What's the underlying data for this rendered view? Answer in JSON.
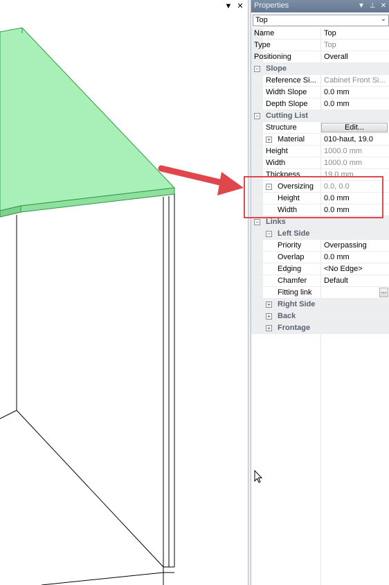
{
  "viewport": {
    "dropdown_icon": "triangle-down-icon",
    "close_icon": "close-icon",
    "dropdown_glyph": "▼",
    "close_glyph": "✕"
  },
  "panel": {
    "title": "Properties",
    "title_buttons": [
      "▼",
      "⊥",
      "✕"
    ],
    "selected_object": "Top"
  },
  "rows": {
    "name": {
      "label": "Name",
      "value": "Top"
    },
    "type": {
      "label": "Type",
      "value": "Top"
    },
    "positioning": {
      "label": "Positioning",
      "value": "Overall"
    },
    "slope": {
      "label": "Slope"
    },
    "reference": {
      "label": "Reference Si...",
      "value": "Cabinet Front Si..."
    },
    "width_slope": {
      "label": "Width Slope",
      "value": "0.0 mm"
    },
    "depth_slope": {
      "label": "Depth Slope",
      "value": "0.0 mm"
    },
    "cutting_list": {
      "label": "Cutting List"
    },
    "structure": {
      "label": "Structure",
      "button": "Edit..."
    },
    "material": {
      "label": "Material",
      "value": "010-haut, 19.0"
    },
    "height": {
      "label": "Height",
      "value": "1000.0 mm"
    },
    "width": {
      "label": "Width",
      "value": "1000.0 mm"
    },
    "thickness": {
      "label": "Thickness",
      "value": "19.0 mm"
    },
    "oversizing": {
      "label": "Oversizing",
      "value": "0.0, 0.0"
    },
    "ov_height": {
      "label": "Height",
      "value": "0.0 mm"
    },
    "ov_width": {
      "label": "Width",
      "value": "0.0 mm"
    },
    "links": {
      "label": "Links"
    },
    "left_side": {
      "label": "Left Side"
    },
    "priority": {
      "label": "Priority",
      "value": "Overpassing"
    },
    "overlap": {
      "label": "Overlap",
      "value": "0.0 mm"
    },
    "edging": {
      "label": "Edging",
      "value": "<No Edge>"
    },
    "chamfer": {
      "label": "Chamfer",
      "value": "Default"
    },
    "fitting_link": {
      "label": "Fitting link",
      "button": "..."
    },
    "right_side": {
      "label": "Right Side"
    },
    "back": {
      "label": "Back"
    },
    "frontage": {
      "label": "Frontage"
    }
  },
  "colors": {
    "panel_fill": "#a8f0b8",
    "panel_edge": "#3aa84a",
    "annotation": "#e0474c",
    "title_bar": "#6e819a"
  }
}
